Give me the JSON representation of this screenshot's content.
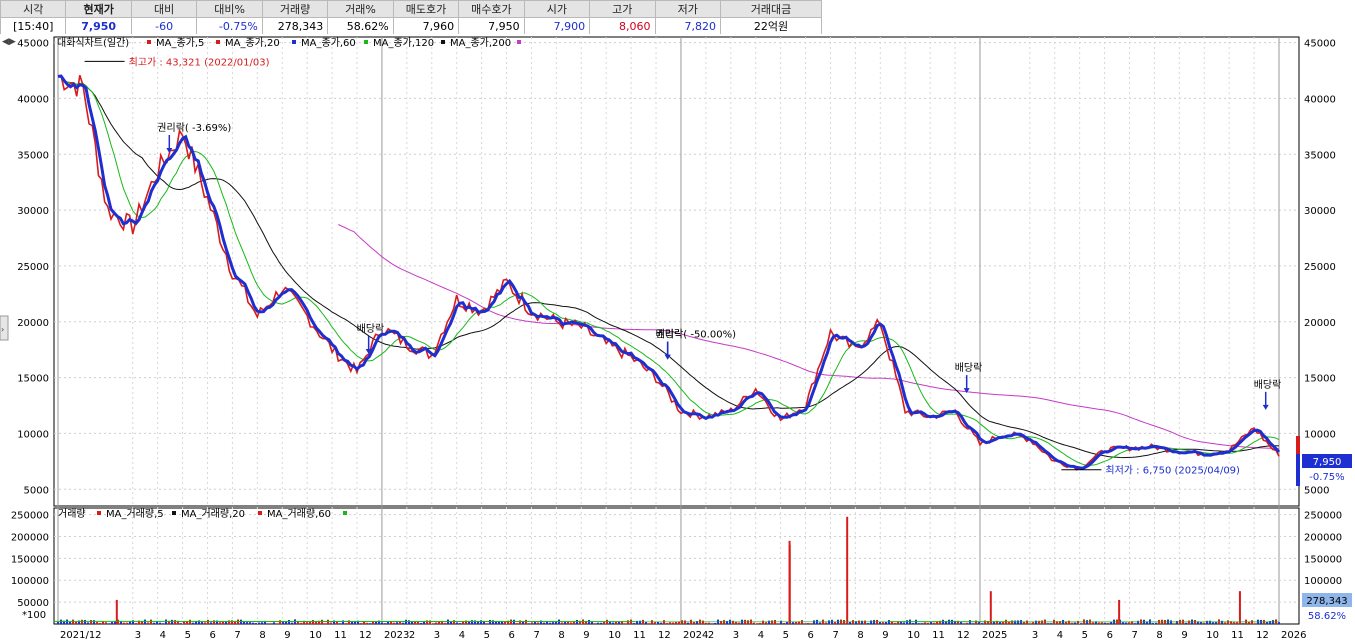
{
  "quote": {
    "headers": [
      "시각",
      "현재가",
      "대비",
      "대비%",
      "거래량",
      "거래%",
      "매도호가",
      "매수호가",
      "시가",
      "고가",
      "저가",
      "거래대금"
    ],
    "values": [
      "[15:40]",
      "7,950",
      "-60",
      "-0.75%",
      "278,343",
      "58.62%",
      "7,960",
      "7,950",
      "7,900",
      "8,060",
      "7,820",
      "22억원"
    ]
  },
  "chart_data": [
    {
      "type": "line",
      "title": "대화식차트(일간)",
      "legend": [
        "MA_종가,5",
        "MA_종가,20",
        "MA_종가,60",
        "MA_종가,120",
        "MA_종가,200"
      ],
      "colors": {
        "price_up": "#d81b1b",
        "ma5": "#d81b1b",
        "ma20": "#1d2fd0",
        "ma60": "#1d2fd0",
        "ma120": "#19b919",
        "ma200": "#111111",
        "ma200_line": "#c63ac6"
      },
      "x_ticks": [
        "2021/12",
        "3",
        "4",
        "5",
        "6",
        "7",
        "8",
        "9",
        "10",
        "11",
        "12",
        "2023",
        "2",
        "3",
        "4",
        "5",
        "6",
        "7",
        "8",
        "9",
        "10",
        "11",
        "12",
        "2024",
        "2",
        "3",
        "4",
        "5",
        "6",
        "7",
        "8",
        "9",
        "10",
        "11",
        "12",
        "2025",
        "3",
        "4",
        "5",
        "6",
        "7",
        "8",
        "9",
        "10",
        "11",
        "12",
        "2026"
      ],
      "y_ticks": [
        45000,
        40000,
        35000,
        30000,
        25000,
        20000,
        15000,
        10000,
        5000
      ],
      "y_tick_labels": [
        "45000",
        "40000",
        "35000",
        "30000",
        "25000",
        "20000",
        "15000",
        "10000",
        "5000"
      ],
      "ylim": [
        3500,
        45500
      ],
      "months": [
        "2021-12",
        "2022-01",
        "2022-02",
        "2022-03",
        "2022-04",
        "2022-05",
        "2022-06",
        "2022-07",
        "2022-08",
        "2022-09",
        "2022-10",
        "2022-11",
        "2022-12",
        "2023-01",
        "2023-02",
        "2023-03",
        "2023-04",
        "2023-05",
        "2023-06",
        "2023-07",
        "2023-08",
        "2023-09",
        "2023-10",
        "2023-11",
        "2023-12",
        "2024-01",
        "2024-02",
        "2024-03",
        "2024-04",
        "2024-05",
        "2024-06",
        "2024-07",
        "2024-08",
        "2024-09",
        "2024-10",
        "2024-11",
        "2024-12",
        "2025-01",
        "2025-02",
        "2025-03",
        "2025-04",
        "2025-05",
        "2025-06",
        "2025-07",
        "2025-08",
        "2025-09",
        "2025-10",
        "2025-11",
        "2025-12",
        "2026-01"
      ],
      "price_close": [
        42000,
        41000,
        30000,
        28500,
        33500,
        37000,
        31000,
        24500,
        20500,
        23000,
        20500,
        17500,
        15500,
        19500,
        18000,
        17000,
        22000,
        21000,
        23500,
        21000,
        20000,
        19500,
        18000,
        16800,
        15000,
        12000,
        11500,
        12000,
        14000,
        11200,
        12500,
        19000,
        17500,
        20000,
        12000,
        11500,
        12000,
        9000,
        10000,
        9500,
        7500,
        6900,
        8500,
        8700,
        8800,
        8400,
        8200,
        8500,
        10500,
        7950
      ],
      "annotations": [
        {
          "text": "최고가 : 43,321 (2022/01/03)",
          "value": 43321,
          "date": "2022-01-03"
        },
        {
          "text": "권리락( -3.69%)",
          "date": "2022-04"
        },
        {
          "text": "배당락",
          "date": "2022-12"
        },
        {
          "text": "권리락( -50.00%)",
          "date": "2023-12"
        },
        {
          "text": "배당락",
          "date": "2023-12"
        },
        {
          "text": "배당락",
          "date": "2024-12"
        },
        {
          "text": "최저가 : 6,750 (2025/04/09)",
          "value": 6750,
          "date": "2025-04-09"
        },
        {
          "text": "배당락",
          "date": "2025-12"
        }
      ],
      "last_price_label": "7,950",
      "last_change_label": "-0.75%"
    },
    {
      "type": "bar",
      "title": "거래량",
      "legend": [
        "MA_거래량,5",
        "MA_거래량,20",
        "MA_거래량,60"
      ],
      "y_ticks": [
        250000,
        200000,
        150000,
        100000,
        50000
      ],
      "y_tick_labels": [
        "250000",
        "200000",
        "150000",
        "100000",
        "50000"
      ],
      "ylim": [
        0,
        265000
      ],
      "unit_label": "*100",
      "spikes": [
        {
          "date": "2022-02",
          "value": 55000
        },
        {
          "date": "2024-05",
          "value": 180000
        },
        {
          "date": "2024-05",
          "value": 190000
        },
        {
          "date": "2024-07",
          "value": 245000
        },
        {
          "date": "2025-01",
          "value": 75000
        },
        {
          "date": "2025-06",
          "value": 55000
        },
        {
          "date": "2025-11",
          "value": 75000
        }
      ],
      "last_volume_label": "278,343",
      "last_ratio_label": "58.62%"
    }
  ]
}
